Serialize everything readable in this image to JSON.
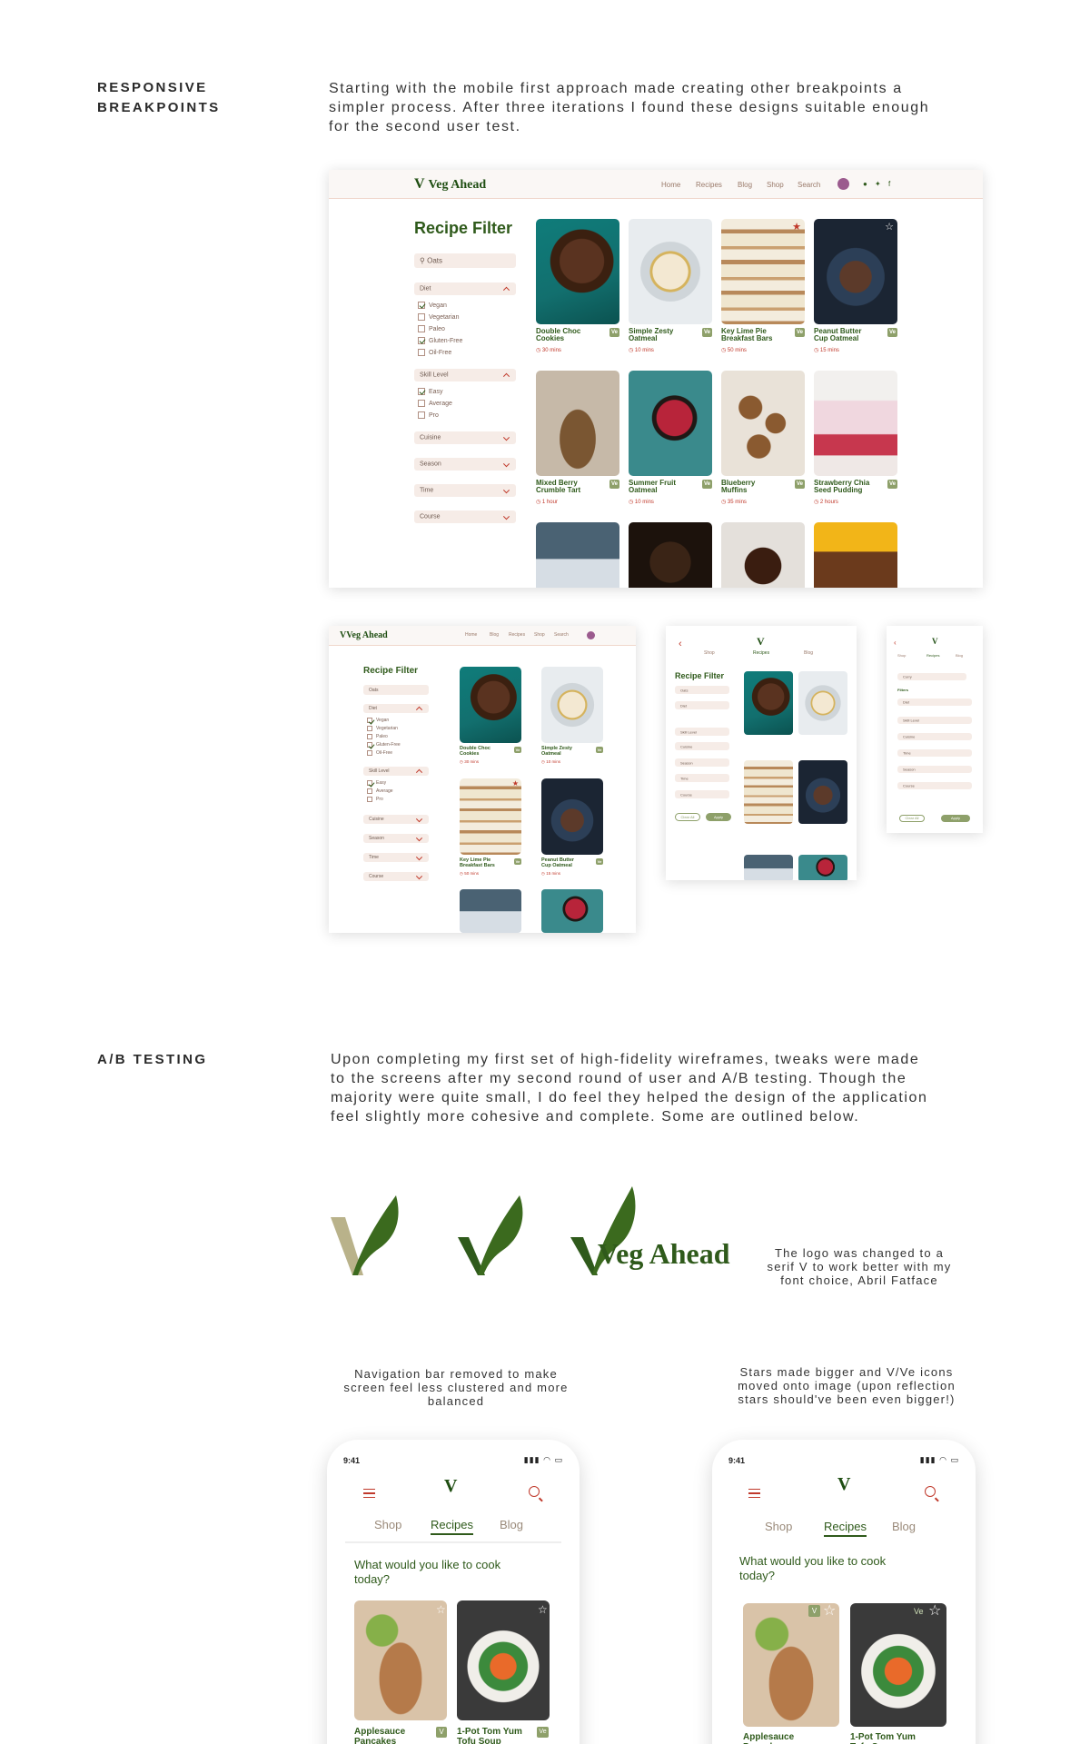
{
  "responsive": {
    "label_line1": "RESPONSIVE",
    "label_line2": "BREAKPOINTS",
    "text_line1": "Starting with the mobile first approach made creating other breakpoints a",
    "text_line2": "simpler process. After three iterations I found these designs suitable enough",
    "text_line3": "for the second user test."
  },
  "brand": {
    "name": "Veg Ahead",
    "logo_icon": "leaf-v-icon"
  },
  "desktop_nav": [
    "Home",
    "Recipes",
    "Blog",
    "Shop",
    "Search"
  ],
  "tablet_nav": [
    "Home",
    "Blog",
    "Recipes",
    "Shop",
    "Search"
  ],
  "filter": {
    "title": "Recipe Filter",
    "search_value": "Oats",
    "diet_label": "Diet",
    "diet_options": [
      "Vegan",
      "Vegetarian",
      "Paleo",
      "Gluten-Free",
      "Oil-Free"
    ],
    "skill_label": "Skill Level",
    "skill_options": [
      "Easy",
      "Average",
      "Pro"
    ],
    "cuisine": "Cuisine",
    "season": "Season",
    "time": "Time",
    "course": "Course",
    "clear_all": "Clear All",
    "apply": "Apply",
    "filters": "Filters",
    "curry_value": "Curry",
    "vegan_chip": "Vegan",
    "gluten_chip": "Gluten-Free",
    "edit": "Edit"
  },
  "recipes": [
    {
      "name1": "Double Choc",
      "name2": "Cookies",
      "time": "30 mins",
      "tag": "Ve"
    },
    {
      "name1": "Simple Zesty",
      "name2": "Oatmeal",
      "time": "10 mins",
      "tag": "Ve"
    },
    {
      "name1": "Key Lime Pie",
      "name2": "Breakfast Bars",
      "time": "50 mins",
      "tag": "Ve"
    },
    {
      "name1": "Peanut Butter",
      "name2": "Cup Oatmeal",
      "time": "15 mins",
      "tag": "Ve"
    },
    {
      "name1": "Mixed Berry",
      "name2": "Crumble Tart",
      "time": "1 hour",
      "tag": "Ve"
    },
    {
      "name1": "Summer Fruit",
      "name2": "Oatmeal",
      "time": "10 mins",
      "tag": "Ve"
    },
    {
      "name1": "Blueberry",
      "name2": "Muffins",
      "time": "35 mins",
      "tag": "Ve"
    },
    {
      "name1": "Strawberry Chia",
      "name2": "Seed Pudding",
      "time": "2 hours",
      "tag": "Ve"
    }
  ],
  "mobile_tabs": [
    "Shop",
    "Recipes",
    "Blog"
  ],
  "ab": {
    "label": "A/B TESTING",
    "text_line1": "Upon completing my first set of high-fidelity wireframes, tweaks were made",
    "text_line2": "to the screens after my second round of user and A/B testing. Though the",
    "text_line3": "majority were quite small, I do feel they helped the design of the application",
    "text_line4": "feel slightly more cohesive and complete. Some are outlined below.",
    "logo_caption_1": "The logo was changed to a",
    "logo_caption_2": "serif V to work better with my",
    "logo_caption_3": "font choice, Abril Fatface",
    "nav_caption_1": "Navigation bar removed to make",
    "nav_caption_2": "screen feel less clustered and more",
    "nav_caption_3": "balanced",
    "star_caption_1": "Stars made bigger and V/Ve icons",
    "star_caption_2": "moved onto image (upon reflection",
    "star_caption_3": "stars should've been even bigger!)"
  },
  "phones": {
    "time": "9:41",
    "question_line1": "What would you like to cook",
    "question_line2": "today?",
    "card1_name1": "Applesauce",
    "card1_name2": "Pancakes",
    "card2_name1": "1-Pot Tom Yum",
    "card2_name2": "Tofu Soup",
    "v_tag": "V",
    "ve_tag": "Ve"
  },
  "colors": {
    "brand_green": "#2f5a1b",
    "accent_red": "#c0392b",
    "tag_green": "#8ea06a",
    "pill_bg": "#f6ece7"
  }
}
